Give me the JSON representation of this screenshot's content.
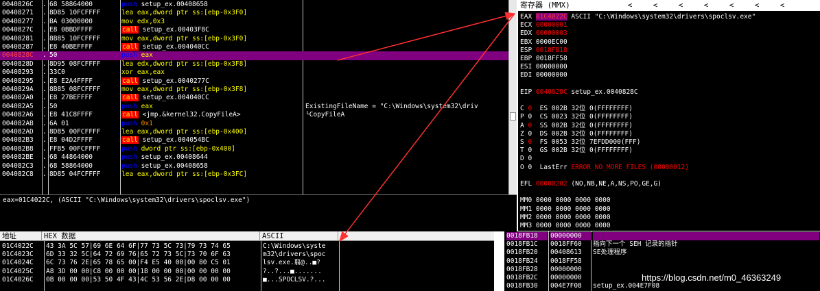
{
  "disassembly": [
    {
      "addr": "0040826C",
      "sep": ".",
      "hex": "68 58864000",
      "mn": "push",
      "mn_type": "push",
      "op": "setup_ex.00408658",
      "op_type": "white",
      "comment": ""
    },
    {
      "addr": "00408271",
      "sep": ".",
      "hex": "8D85 10FCFFFF",
      "mn": "lea",
      "mn_type": "movlea",
      "op": "eax,dword ptr ss:[ebp-0x3F0]",
      "op_type": "yellow",
      "comment": ""
    },
    {
      "addr": "00408277",
      "sep": ".",
      "hex": "BA 03000000",
      "mn": "mov",
      "mn_type": "movlea",
      "op": "edx,0x3",
      "op_type": "yellow",
      "comment": ""
    },
    {
      "addr": "0040827C",
      "sep": ".",
      "hex": "E8 0BBDFFFF",
      "mn": "call",
      "mn_type": "call",
      "op": "setup_ex.00403F8C",
      "op_type": "white",
      "comment": ""
    },
    {
      "addr": "00408281",
      "sep": ".",
      "hex": "8B85 10FCFFFF",
      "mn": "mov",
      "mn_type": "movlea",
      "op": "eax,dword ptr ss:[ebp-0x3F0]",
      "op_type": "yellow",
      "comment": ""
    },
    {
      "addr": "00408287",
      "sep": ".",
      "hex": "E8 40BEFFFF",
      "mn": "call",
      "mn_type": "call",
      "op": "setup_ex.004040CC",
      "op_type": "white",
      "comment": ""
    },
    {
      "addr": "0040828C",
      "sep": ".",
      "hex": "50",
      "mn": "push",
      "mn_type": "push",
      "op": "eax",
      "op_type": "yellow",
      "comment": "",
      "selected": true
    },
    {
      "addr": "0040828D",
      "sep": ".",
      "hex": "8D95 08FCFFFF",
      "mn": "lea",
      "mn_type": "movlea",
      "op": "edx,dword ptr ss:[ebp-0x3F8]",
      "op_type": "yellow",
      "comment": ""
    },
    {
      "addr": "00408293",
      "sep": ".",
      "hex": "33C0",
      "mn": "xor",
      "mn_type": "movlea",
      "op": "eax,eax",
      "op_type": "yellow",
      "comment": ""
    },
    {
      "addr": "00408295",
      "sep": ".",
      "hex": "E8 E2A4FFFF",
      "mn": "call",
      "mn_type": "call",
      "op": "setup_ex.0040277C",
      "op_type": "white",
      "comment": ""
    },
    {
      "addr": "0040829A",
      "sep": ".",
      "hex": "8B85 08FCFFFF",
      "mn": "mov",
      "mn_type": "movlea",
      "op": "eax,dword ptr ss:[ebp-0x3F8]",
      "op_type": "yellow",
      "comment": ""
    },
    {
      "addr": "004082A0",
      "sep": ".",
      "hex": "E8 27BEFFFF",
      "mn": "call",
      "mn_type": "call",
      "op": "setup_ex.004040CC",
      "op_type": "white",
      "comment": ""
    },
    {
      "addr": "004082A5",
      "sep": ".",
      "hex": "50",
      "mn": "push",
      "mn_type": "push",
      "op": "eax",
      "op_type": "yellow",
      "comment": "ExistingFileName = \"C:\\Windows\\system32\\driv",
      "comment_type": "white"
    },
    {
      "addr": "004082A6",
      "sep": ".",
      "hex": "E8 41C8FFFF",
      "mn": "call",
      "mn_type": "call",
      "op": "<jmp.&kernel32.CopyFileA>",
      "op_type": "white",
      "comment": "└CopyFileA",
      "comment_type": "red"
    },
    {
      "addr": "004082AB",
      "sep": ".",
      "hex": "6A 01",
      "mn": "push",
      "mn_type": "push",
      "op": "0x1",
      "op_type": "num",
      "comment": ""
    },
    {
      "addr": "004082AD",
      "sep": ".",
      "hex": "8D85 00FCFFFF",
      "mn": "lea",
      "mn_type": "movlea",
      "op": "eax,dword ptr ss:[ebp-0x400]",
      "op_type": "yellow",
      "comment": ""
    },
    {
      "addr": "004082B3",
      "sep": ".",
      "hex": "E8 04D2FFFF",
      "mn": "call",
      "mn_type": "call",
      "op": "setup_ex.004054BC",
      "op_type": "white",
      "comment": ""
    },
    {
      "addr": "004082B8",
      "sep": ".",
      "hex": "FFB5 00FCFFFF",
      "mn": "push",
      "mn_type": "push",
      "op": "dword ptr ss:[ebp-0x400]",
      "op_type": "yellow",
      "comment": ""
    },
    {
      "addr": "004082BE",
      "sep": ".",
      "hex": "68 44864000",
      "mn": "push",
      "mn_type": "push",
      "op": "setup_ex.00408644",
      "op_type": "white",
      "comment": ""
    },
    {
      "addr": "004082C3",
      "sep": ".",
      "hex": "68 58864000",
      "mn": "push",
      "mn_type": "push",
      "op": "setup_ex.00408658",
      "op_type": "white",
      "comment": ""
    },
    {
      "addr": "004082C8",
      "sep": ".",
      "hex": "8D85 04FCFFFF",
      "mn": "lea",
      "mn_type": "movlea",
      "op": "eax,dword ptr ss:[ebp-0x3FC]",
      "op_type": "yellow",
      "comment": ""
    }
  ],
  "info_line": "eax=01C4022C, (ASCII \"C:\\Windows\\system32\\drivers\\spoclsv.exe\")",
  "registers": {
    "title": "寄存器 (MMX)",
    "nav_arrows": [
      "<",
      "<",
      "<",
      "<",
      "<",
      "<",
      "<"
    ],
    "lines": [
      {
        "name": "EAX",
        "value": "01C4022C",
        "value_style": "hi",
        "extra": " ASCII \"C:\\Windows\\system32\\drivers\\spoclsv.exe\""
      },
      {
        "name": "ECX",
        "value": "00000001",
        "value_style": "red",
        "extra": ""
      },
      {
        "name": "EDX",
        "value": "00000003",
        "value_style": "red",
        "extra": ""
      },
      {
        "name": "EBX",
        "value": "0000EC00",
        "value_style": "white",
        "extra": ""
      },
      {
        "name": "ESP",
        "value": "0018FB18",
        "value_style": "red",
        "extra": ""
      },
      {
        "name": "EBP",
        "value": "0018FF58",
        "value_style": "white",
        "extra": ""
      },
      {
        "name": "ESI",
        "value": "00000000",
        "value_style": "white",
        "extra": ""
      },
      {
        "name": "EDI",
        "value": "00000000",
        "value_style": "white",
        "extra": ""
      },
      {
        "name": "",
        "value": "",
        "value_style": "white",
        "extra": ""
      },
      {
        "name": "EIP",
        "value": "0040828C",
        "value_style": "red",
        "extra": " setup_ex.0040828C"
      },
      {
        "name": "",
        "value": "",
        "value_style": "white",
        "extra": ""
      },
      {
        "name": "C",
        "value": "0",
        "value_style": "red",
        "extra": "  ES 002B 32位 0(FFFFFFFF)"
      },
      {
        "name": "P",
        "value": "0",
        "value_style": "white",
        "extra": "  CS 0023 32位 0(FFFFFFFF)"
      },
      {
        "name": "A",
        "value": "0",
        "value_style": "red",
        "extra": "  SS 002B 32位 0(FFFFFFFF)"
      },
      {
        "name": "Z",
        "value": "0",
        "value_style": "white",
        "extra": "  DS 002B 32位 0(FFFFFFFF)"
      },
      {
        "name": "S",
        "value": "0",
        "value_style": "red",
        "extra": "  FS 0053 32位 7EFDD000(FFF)"
      },
      {
        "name": "T",
        "value": "0",
        "value_style": "white",
        "extra": "  GS 002B 32位 0(FFFFFFFF)"
      },
      {
        "name": "D",
        "value": "0",
        "value_style": "white",
        "extra": ""
      },
      {
        "name": "O",
        "value": "0",
        "value_style": "white",
        "extra": "  LastErr "
      },
      {
        "name": "",
        "value": "",
        "value_style": "white",
        "extra": ""
      },
      {
        "name": "EFL",
        "value": "00000202",
        "value_style": "red",
        "extra": " (NO,NB,NE,A,NS,PO,GE,G)"
      },
      {
        "name": "",
        "value": "",
        "value_style": "white",
        "extra": ""
      },
      {
        "name": "MM0",
        "value": "0000 0000 0000 0000",
        "value_style": "white",
        "extra": ""
      },
      {
        "name": "MM1",
        "value": "0000 0000 0000 0000",
        "value_style": "white",
        "extra": ""
      },
      {
        "name": "MM2",
        "value": "0000 0000 0000 0000",
        "value_style": "white",
        "extra": ""
      },
      {
        "name": "MM3",
        "value": "0000 0000 0000 0000",
        "value_style": "white",
        "extra": ""
      }
    ],
    "last_error": "ERROR_NO_MORE_FILES (00000012)"
  },
  "dump": {
    "headers": {
      "addr": "地址",
      "hex": "HEX 数据",
      "ascii": "ASCII"
    },
    "rows": [
      {
        "addr": "01C4022C",
        "hex": "43 3A 5C 57|69 6E 64 6F|77 73 5C 73|79 73 74 65",
        "ascii": "C:\\Windows\\syste"
      },
      {
        "addr": "01C4023C",
        "hex": "6D 33 32 5C|64 72 69 76|65 72 73 5C|73 70 6F 63",
        "ascii": "m32\\drivers\\spoc"
      },
      {
        "addr": "01C4024C",
        "hex": "6C 73 76 2E|65 78 65 00|F4 E5 40 00|00 80 C5 01",
        "ascii": "lsv.exe.翦@..■?"
      },
      {
        "addr": "01C4025C",
        "hex": "A8 3D 00 00|C8 00 00 00|1B 00 00 00|00 00 00 00",
        "ascii": "?..?...■......."
      },
      {
        "addr": "01C4026C",
        "hex": "0B 00 00 00|53 50 4F 43|4C 53 56 2E|D8 00 00 00",
        "ascii": "■...SPOCLSV.?..."
      }
    ]
  },
  "stack": {
    "rows": [
      {
        "addr": "0018FB18",
        "val": "00000000",
        "comment": "",
        "selected": true
      },
      {
        "addr": "0018FB1C",
        "val": "0018FF60",
        "comment": "指向下一个 SEH 记录的指针"
      },
      {
        "addr": "0018FB20",
        "val": "00408613",
        "comment": "SE处理程序"
      },
      {
        "addr": "0018FB24",
        "val": "0018FF58",
        "comment": ""
      },
      {
        "addr": "0018FB28",
        "val": "00000000",
        "comment": ""
      },
      {
        "addr": "0018FB2C",
        "val": "00000000",
        "comment": ""
      },
      {
        "addr": "0018FB30",
        "val": "004E7F08",
        "comment": "setup_ex.004E7F08"
      }
    ]
  },
  "watermark": "https://blog.csdn.net/m0_46363249",
  "colors": {
    "arrow": "#ff3030",
    "selection": "#800080"
  }
}
